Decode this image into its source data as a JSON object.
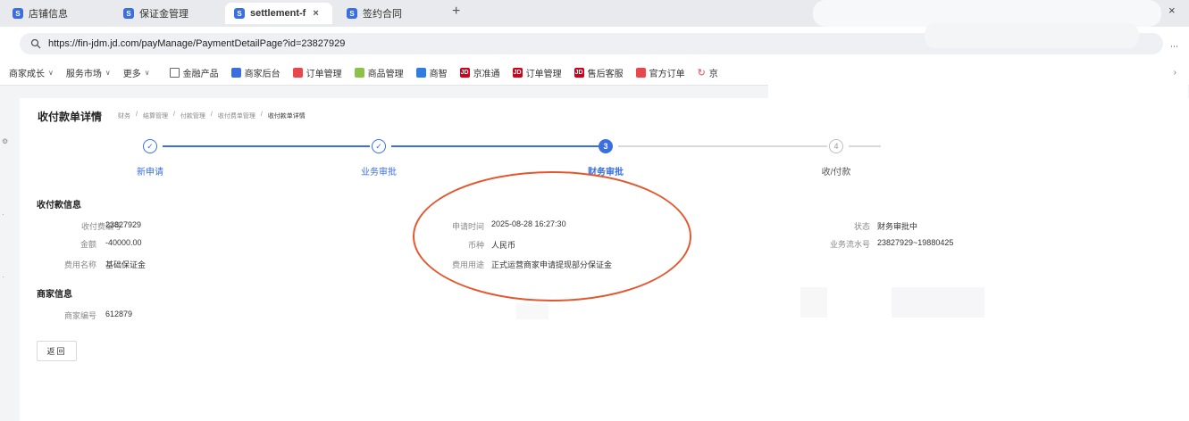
{
  "browser": {
    "tabs": [
      {
        "label": "店铺信息",
        "favicon": "S"
      },
      {
        "label": "保证金管理",
        "favicon": "S"
      },
      {
        "label": "settlement-f",
        "favicon": "S"
      },
      {
        "label": "签约合同",
        "favicon": "S"
      }
    ],
    "new_tab": "+",
    "window_controls": {
      "chevrons": "«",
      "close": "×"
    },
    "url": "https://fin-jdm.jd.com/payManage/PaymentDetailPage?id=23827929",
    "bookmarks": [
      {
        "label": "商家成长",
        "icon": "chevron-down-icon",
        "color": ""
      },
      {
        "label": "服务市场",
        "icon": "chevron-down-icon",
        "color": ""
      },
      {
        "label": "更多",
        "icon": "chevron-down-icon",
        "color": ""
      },
      {
        "label": "金融产品",
        "icon": "folder-icon",
        "color": "#666666"
      },
      {
        "label": "商家后台",
        "icon": "square-icon",
        "color": "#3b6fe0"
      },
      {
        "label": "订单管理",
        "icon": "square-icon",
        "color": "#e8474c"
      },
      {
        "label": "商品管理",
        "icon": "square-icon",
        "color": "#8bc34a"
      },
      {
        "label": "商智",
        "icon": "square-icon",
        "color": "#2f7de1"
      },
      {
        "label": "京准通",
        "icon": "jd-icon",
        "color": "#d0021b"
      },
      {
        "label": "订单管理",
        "icon": "jd-icon",
        "color": "#d0021b"
      },
      {
        "label": "售后客服",
        "icon": "jd-icon",
        "color": "#d0021b"
      },
      {
        "label": "官方订单",
        "icon": "square-icon",
        "color": "#e8474c"
      },
      {
        "label": "京",
        "icon": "refresh-icon",
        "color": "#e8474c"
      }
    ]
  },
  "page": {
    "title": "收付款单详情",
    "breadcrumb": [
      "财务",
      "结算管理",
      "付款管理",
      "收付费单管理",
      "收付款单详情"
    ],
    "steps": [
      {
        "label": "新申请",
        "status": "done",
        "mark": "✓"
      },
      {
        "label": "业务审批",
        "status": "done",
        "mark": "✓"
      },
      {
        "label": "财务审批",
        "status": "current",
        "mark": "3"
      },
      {
        "label": "收/付款",
        "status": "todo",
        "mark": "4"
      }
    ],
    "payment_info": {
      "title": "收付款信息",
      "fields": [
        {
          "label": "收付费编号",
          "value": "23827929"
        },
        {
          "label": "金额",
          "value": "-40000.00"
        },
        {
          "label": "费用名称",
          "value": "基础保证金"
        },
        {
          "label": "申请时间",
          "value": "2025-08-28 16:27:30"
        },
        {
          "label": "币种",
          "value": "人民币"
        },
        {
          "label": "费用用途",
          "value": "正式运营商家申请提现部分保证金"
        },
        {
          "label": "状态",
          "value": "财务审批中"
        },
        {
          "label": "业务流水号",
          "value": "23827929~19880425"
        }
      ]
    },
    "merchant_info": {
      "title": "商家信息",
      "fields": [
        {
          "label": "商家编号",
          "value": "612879"
        }
      ]
    },
    "back_button": "返回"
  },
  "colors": {
    "accent": "#3b6fe0",
    "annotation": "#e4572e"
  }
}
